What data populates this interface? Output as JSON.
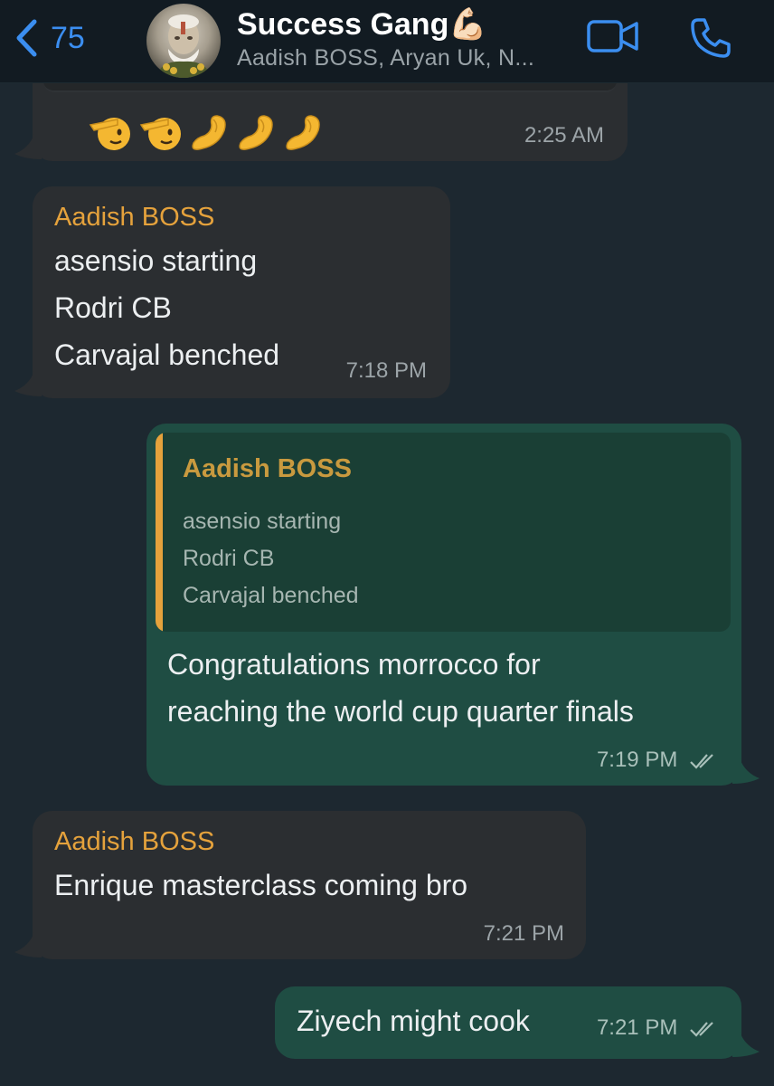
{
  "header": {
    "back_count": "75",
    "title": "Success Gang",
    "title_emoji": "💪🏻",
    "subtitle": "Aadish BOSS, Aryan Uk, N...",
    "icons": {
      "back": "chevron-left-icon",
      "video": "video-call-icon",
      "phone": "phone-call-icon"
    }
  },
  "colors": {
    "chat_background": "#1d2830",
    "incoming_bubble": "#2b2e31",
    "outgoing_bubble": "#1f4d43",
    "sender_name": "#e5a23c",
    "accent": "#3b8ef0"
  },
  "messages": [
    {
      "direction": "incoming",
      "emoji": "🫡🫡🤌🤌🤌",
      "time": "2:25 AM"
    },
    {
      "direction": "incoming",
      "sender": "Aadish BOSS",
      "lines": [
        "asensio starting",
        "Rodri CB",
        "Carvajal benched"
      ],
      "time": "7:18 PM"
    },
    {
      "direction": "outgoing",
      "quote": {
        "sender": "Aadish BOSS",
        "lines": [
          "asensio starting",
          "Rodri CB",
          "Carvajal benched"
        ]
      },
      "lines": [
        "Congratulations morrocco for",
        "reaching the world cup quarter finals"
      ],
      "time": "7:19 PM",
      "status": "read"
    },
    {
      "direction": "incoming",
      "sender": "Aadish BOSS",
      "lines": [
        "Enrique masterclass coming bro"
      ],
      "time": "7:21 PM"
    },
    {
      "direction": "outgoing",
      "lines": [
        "Ziyech might cook"
      ],
      "time": "7:21 PM",
      "status": "read"
    }
  ]
}
